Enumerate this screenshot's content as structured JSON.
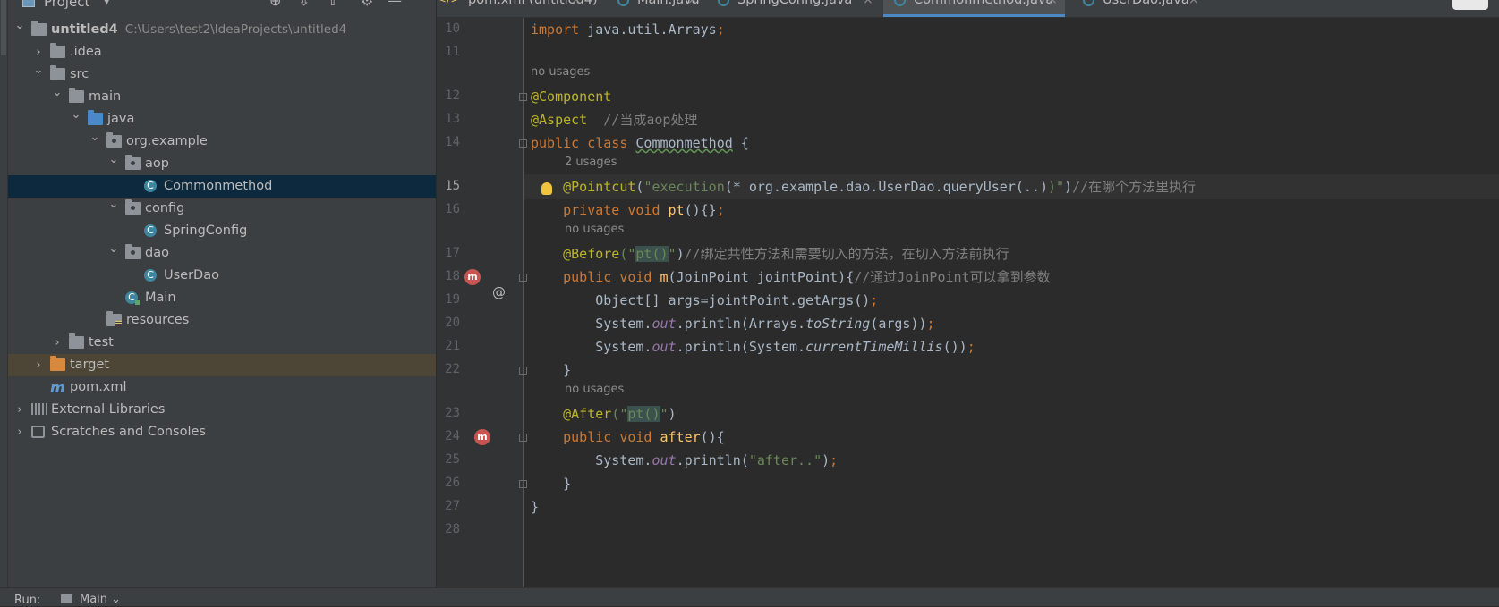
{
  "project": {
    "title": "Project",
    "tree": [
      {
        "label": "untitled4",
        "path": "C:\\Users\\test2\\IdeaProjects\\untitled4",
        "depth": 0,
        "chev": "down",
        "icon": "folder-icon"
      },
      {
        "label": ".idea",
        "depth": 1,
        "chev": "right",
        "icon": "folder-icon"
      },
      {
        "label": "src",
        "depth": 1,
        "chev": "down",
        "icon": "folder-icon"
      },
      {
        "label": "main",
        "depth": 2,
        "chev": "down",
        "icon": "folder-icon"
      },
      {
        "label": "java",
        "depth": 3,
        "chev": "down",
        "icon": "source-folder-icon"
      },
      {
        "label": "org.example",
        "depth": 4,
        "chev": "down",
        "icon": "package-icon"
      },
      {
        "label": "aop",
        "depth": 5,
        "chev": "down",
        "icon": "package-icon"
      },
      {
        "label": "Commonmethod",
        "depth": 6,
        "icon": "class-icon",
        "selected": true
      },
      {
        "label": "config",
        "depth": 5,
        "chev": "down",
        "icon": "package-icon"
      },
      {
        "label": "SpringConfig",
        "depth": 6,
        "icon": "class-icon"
      },
      {
        "label": "dao",
        "depth": 5,
        "chev": "down",
        "icon": "package-icon"
      },
      {
        "label": "UserDao",
        "depth": 6,
        "icon": "class-icon"
      },
      {
        "label": "Main",
        "depth": 5,
        "icon": "main-class-icon"
      },
      {
        "label": "resources",
        "depth": 4,
        "icon": "resources-folder-icon"
      },
      {
        "label": "test",
        "depth": 2,
        "chev": "right",
        "icon": "folder-icon"
      },
      {
        "label": "target",
        "depth": 1,
        "chev": "right",
        "icon": "excluded-folder-icon",
        "highlighted": true
      },
      {
        "label": "pom.xml",
        "depth": 1,
        "icon": "maven-icon"
      },
      {
        "label": "External Libraries",
        "depth": 0,
        "chev": "right",
        "icon": "libraries-icon"
      },
      {
        "label": "Scratches and Consoles",
        "depth": 0,
        "chev": "right",
        "icon": "scratches-icon"
      }
    ]
  },
  "tabs": [
    {
      "label": "pom.xml (untitled4)",
      "icon": "maven-icon"
    },
    {
      "label": "Main.java",
      "icon": "class-icon"
    },
    {
      "label": "SpringConfig.java",
      "icon": "class-icon"
    },
    {
      "label": "Commonmethod.java",
      "icon": "class-icon",
      "active": true
    },
    {
      "label": "UserDao.java",
      "icon": "class-icon"
    }
  ],
  "editor": {
    "current_line": "15",
    "lines": [
      {
        "n": "10",
        "segs": [
          {
            "t": "import ",
            "c": "kw"
          },
          {
            "t": "java.util.Arrays"
          },
          {
            "t": ";",
            "c": "kw"
          }
        ]
      },
      {
        "n": "11",
        "segs": []
      },
      {
        "hint": "no usages"
      },
      {
        "n": "12",
        "segs": [
          {
            "t": "@Component",
            "c": "ann"
          }
        ]
      },
      {
        "n": "13",
        "segs": [
          {
            "t": "@Aspect",
            "c": "ann"
          },
          {
            "t": "  //当成aop处理",
            "c": "cm"
          }
        ]
      },
      {
        "n": "14",
        "segs": [
          {
            "t": "public class ",
            "c": "kw"
          },
          {
            "t": "Commonmethod",
            "c": "ul"
          },
          {
            "t": " {"
          }
        ]
      },
      {
        "hint": "2 usages",
        "indent": 1
      },
      {
        "n": "15",
        "segs": [
          {
            "t": "    "
          },
          {
            "t": "@Pointcut",
            "c": "ann"
          },
          {
            "t": "("
          },
          {
            "t": "\"execution",
            "c": "str"
          },
          {
            "t": "(* org.example.dao.UserDao.queryUser(..)"
          },
          {
            "t": ")\"",
            "c": "str"
          },
          {
            "t": ")"
          },
          {
            "t": "//在哪个方法里执行",
            "c": "cm"
          }
        ]
      },
      {
        "n": "16",
        "segs": [
          {
            "t": "    "
          },
          {
            "t": "private void ",
            "c": "kw"
          },
          {
            "t": "pt",
            "c": "fn"
          },
          {
            "t": "(){}"
          },
          {
            "t": ";",
            "c": "kw"
          }
        ]
      },
      {
        "hint": "no usages",
        "indent": 1
      },
      {
        "n": "17",
        "segs": [
          {
            "t": "    "
          },
          {
            "t": "@Before",
            "c": "ann"
          },
          {
            "t": "(\"",
            "c": "str"
          },
          {
            "t": "pt()",
            "c": "str paren"
          },
          {
            "t": "\"",
            "c": "str"
          },
          {
            "t": ")"
          },
          {
            "t": "//绑定共性方法和需要切入的方法，在切入方法前执行",
            "c": "cm"
          }
        ]
      },
      {
        "n": "18",
        "segs": [
          {
            "t": "    "
          },
          {
            "t": "public void ",
            "c": "kw"
          },
          {
            "t": "m",
            "c": "fn"
          },
          {
            "t": "(JoinPoint jointPoint){"
          },
          {
            "t": "//通过JoinPoint可以拿到参数",
            "c": "cm"
          }
        ]
      },
      {
        "n": "19",
        "segs": [
          {
            "t": "        Object[] args=jointPoint.getArgs()"
          },
          {
            "t": ";",
            "c": "kw"
          }
        ]
      },
      {
        "n": "20",
        "segs": [
          {
            "t": "        System."
          },
          {
            "t": "out",
            "c": "fld"
          },
          {
            "t": ".println(Arrays."
          },
          {
            "t": "toString",
            "c": "it"
          },
          {
            "t": "(args))"
          },
          {
            "t": ";",
            "c": "kw"
          }
        ]
      },
      {
        "n": "21",
        "segs": [
          {
            "t": "        System."
          },
          {
            "t": "out",
            "c": "fld"
          },
          {
            "t": ".println(System."
          },
          {
            "t": "currentTimeMillis",
            "c": "it"
          },
          {
            "t": "())"
          },
          {
            "t": ";",
            "c": "kw"
          }
        ]
      },
      {
        "n": "22",
        "segs": [
          {
            "t": "    }"
          }
        ]
      },
      {
        "hint": "no usages",
        "indent": 1
      },
      {
        "n": "23",
        "segs": [
          {
            "t": "    "
          },
          {
            "t": "@After",
            "c": "ann"
          },
          {
            "t": "(\"",
            "c": "str"
          },
          {
            "t": "pt()",
            "c": "str paren"
          },
          {
            "t": "\"",
            "c": "str"
          },
          {
            "t": ")"
          }
        ]
      },
      {
        "n": "24",
        "segs": [
          {
            "t": "    "
          },
          {
            "t": "public void ",
            "c": "kw"
          },
          {
            "t": "after",
            "c": "fn"
          },
          {
            "t": "(){"
          }
        ]
      },
      {
        "n": "25",
        "segs": [
          {
            "t": "        System."
          },
          {
            "t": "out",
            "c": "fld"
          },
          {
            "t": ".println("
          },
          {
            "t": "\"after..\"",
            "c": "str"
          },
          {
            "t": ")"
          },
          {
            "t": ";",
            "c": "kw"
          }
        ]
      },
      {
        "n": "26",
        "segs": [
          {
            "t": "    }"
          }
        ]
      },
      {
        "n": "27",
        "segs": [
          {
            "t": "}"
          }
        ]
      },
      {
        "n": "28",
        "segs": []
      }
    ]
  },
  "gutter_marks": {
    "at_symbol": "@",
    "method_marker": "m"
  },
  "run_bar": {
    "label": "Run:",
    "tab": "Main"
  }
}
